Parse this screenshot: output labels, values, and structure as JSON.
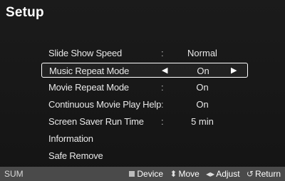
{
  "title": "Setup",
  "menu": [
    {
      "label": "Slide Show Speed",
      "colon": ":",
      "value": "Normal"
    },
    {
      "label": "Music Repeat Mode",
      "value": "On"
    },
    {
      "label": "Movie Repeat Mode",
      "colon": ":",
      "value": "On"
    },
    {
      "label": "Continuous Movie Play Help",
      "colon": ":",
      "value": "On"
    },
    {
      "label": "Screen Saver Run Time",
      "colon": ":",
      "value": "5 min"
    },
    {
      "label": "Information"
    },
    {
      "label": "Safe Remove"
    }
  ],
  "selected_index": 1,
  "footer": {
    "brand": "SUM",
    "hints": [
      {
        "icon": "square-icon",
        "label": "Device"
      },
      {
        "icon": "updown-arrows-icon",
        "glyph": "⬍",
        "label": "Move"
      },
      {
        "icon": "leftright-arrows-icon",
        "glyph": "◂▸",
        "label": "Adjust"
      },
      {
        "icon": "return-icon",
        "glyph": "↺",
        "label": "Return"
      }
    ]
  },
  "colors": {
    "background": "#171717",
    "footer": "#4a4a4a",
    "text": "#ffffff"
  }
}
